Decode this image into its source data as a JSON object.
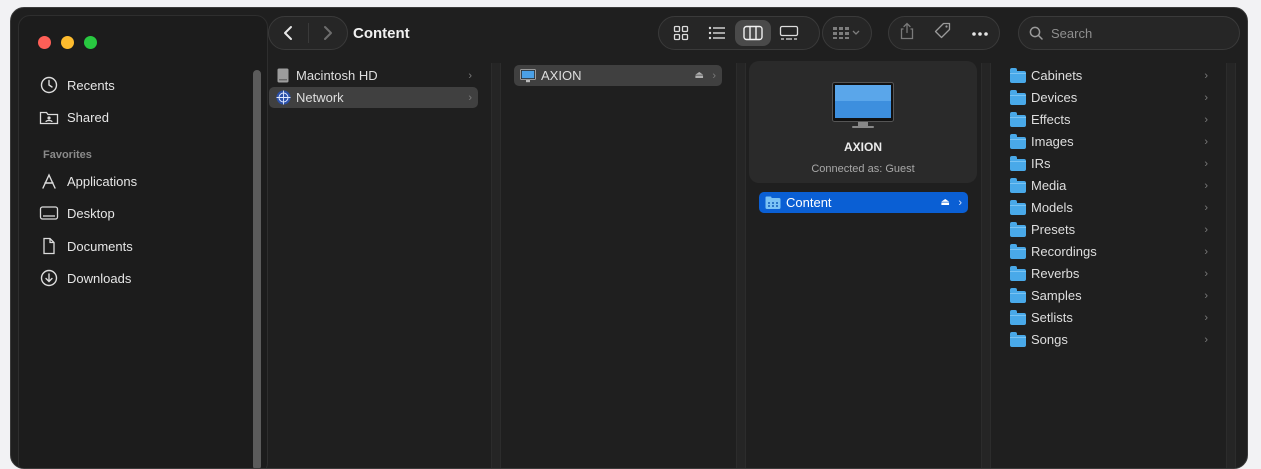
{
  "window": {
    "title": "Content"
  },
  "sidebar": {
    "items": [
      {
        "label": "Recents",
        "icon": "clock-icon"
      },
      {
        "label": "Shared",
        "icon": "shared-folder-icon"
      }
    ],
    "favorites_heading": "Favorites",
    "favorites": [
      {
        "label": "Applications",
        "icon": "applications-icon"
      },
      {
        "label": "Desktop",
        "icon": "desktop-icon"
      },
      {
        "label": "Documents",
        "icon": "document-icon"
      },
      {
        "label": "Downloads",
        "icon": "download-icon"
      }
    ]
  },
  "toolbar": {
    "search_placeholder": "Search",
    "selected_view": "columns"
  },
  "columns": {
    "col1": [
      {
        "label": "Macintosh HD",
        "icon": "hard-drive-icon",
        "state": "none"
      },
      {
        "label": "Network",
        "icon": "network-globe-icon",
        "state": "highlighted"
      }
    ],
    "col2": [
      {
        "label": "AXION",
        "icon": "computer-icon",
        "state": "highlighted",
        "eject": true
      }
    ],
    "col3": {
      "server_name": "AXION",
      "connected_as": "Connected as: Guest",
      "items": [
        {
          "label": "Content",
          "icon": "network-share-icon",
          "state": "selected",
          "eject": true
        }
      ]
    },
    "col4": [
      {
        "label": "Cabinets"
      },
      {
        "label": "Devices"
      },
      {
        "label": "Effects"
      },
      {
        "label": "Images"
      },
      {
        "label": "IRs"
      },
      {
        "label": "Media"
      },
      {
        "label": "Models"
      },
      {
        "label": "Presets"
      },
      {
        "label": "Recordings"
      },
      {
        "label": "Reverbs"
      },
      {
        "label": "Samples"
      },
      {
        "label": "Setlists"
      },
      {
        "label": "Songs"
      }
    ]
  },
  "colors": {
    "selection": "#0a5fd4",
    "folder": "#49a9e9",
    "window_bg": "#1f1f1f"
  }
}
